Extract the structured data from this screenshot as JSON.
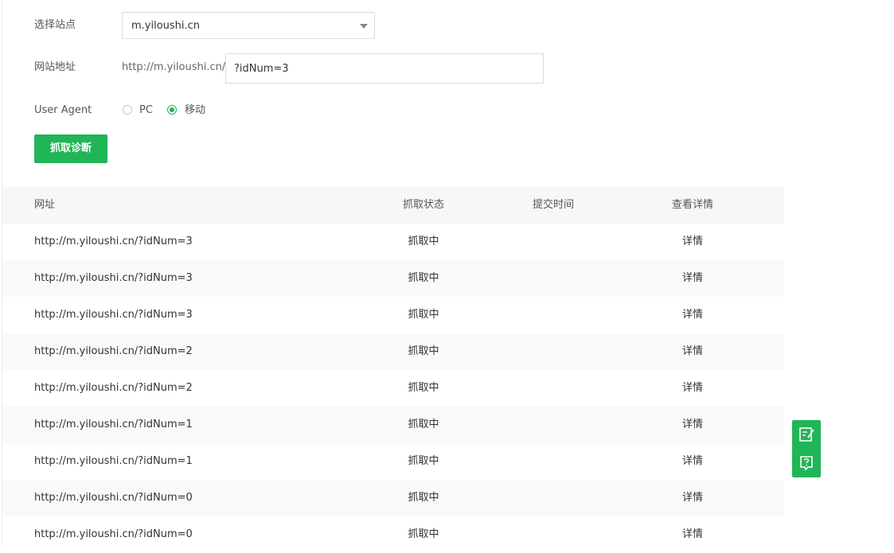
{
  "form": {
    "site_label": "选择站点",
    "site_value": "m.yiloushi.cn",
    "url_label": "网站地址",
    "url_prefix": "http://m.yiloushi.cn/",
    "url_value": "?idNum=3",
    "ua_label": "User Agent",
    "ua_options": [
      {
        "label": "PC",
        "selected": false
      },
      {
        "label": "移动",
        "selected": true
      }
    ],
    "submit_label": "抓取诊断"
  },
  "table": {
    "headers": [
      "网址",
      "抓取状态",
      "提交时间",
      "查看详情"
    ],
    "rows": [
      {
        "url": "http://m.yiloushi.cn/?idNum=3",
        "status": "抓取中",
        "time": "",
        "detail": "详情"
      },
      {
        "url": "http://m.yiloushi.cn/?idNum=3",
        "status": "抓取中",
        "time": "",
        "detail": "详情"
      },
      {
        "url": "http://m.yiloushi.cn/?idNum=3",
        "status": "抓取中",
        "time": "",
        "detail": "详情"
      },
      {
        "url": "http://m.yiloushi.cn/?idNum=2",
        "status": "抓取中",
        "time": "",
        "detail": "详情"
      },
      {
        "url": "http://m.yiloushi.cn/?idNum=2",
        "status": "抓取中",
        "time": "",
        "detail": "详情"
      },
      {
        "url": "http://m.yiloushi.cn/?idNum=1",
        "status": "抓取中",
        "time": "",
        "detail": "详情"
      },
      {
        "url": "http://m.yiloushi.cn/?idNum=1",
        "status": "抓取中",
        "time": "",
        "detail": "详情"
      },
      {
        "url": "http://m.yiloushi.cn/?idNum=0",
        "status": "抓取中",
        "time": "",
        "detail": "详情"
      },
      {
        "url": "http://m.yiloushi.cn/?idNum=0",
        "status": "抓取中",
        "time": "",
        "detail": "详情"
      }
    ]
  },
  "float_tools": [
    {
      "icon": "edit-note-icon"
    },
    {
      "icon": "help-question-icon"
    }
  ],
  "colors": {
    "accent": "#20b557",
    "header_bg": "#f7f7f7",
    "stripe_bg": "#f9f9f9"
  }
}
